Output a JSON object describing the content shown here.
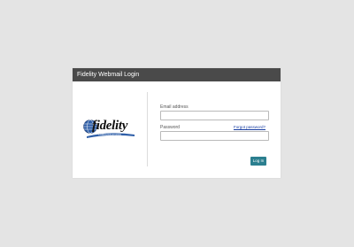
{
  "window": {
    "title": "Fidelity Webmail Login"
  },
  "logo": {
    "text": "fidelity",
    "tagline": "COMMUNICATIONS",
    "icon": "fidelity-globe-logo"
  },
  "form": {
    "email_label": "Email address",
    "email_value": "",
    "password_label": "Password",
    "password_value": "",
    "forgot_link": "Forgot password?",
    "login_button": "Log In"
  },
  "colors": {
    "header_bg": "#4a4a4a",
    "button_bg": "#2b7f8f",
    "link": "#1a3fa3",
    "page_bg": "#e4e4e4"
  }
}
